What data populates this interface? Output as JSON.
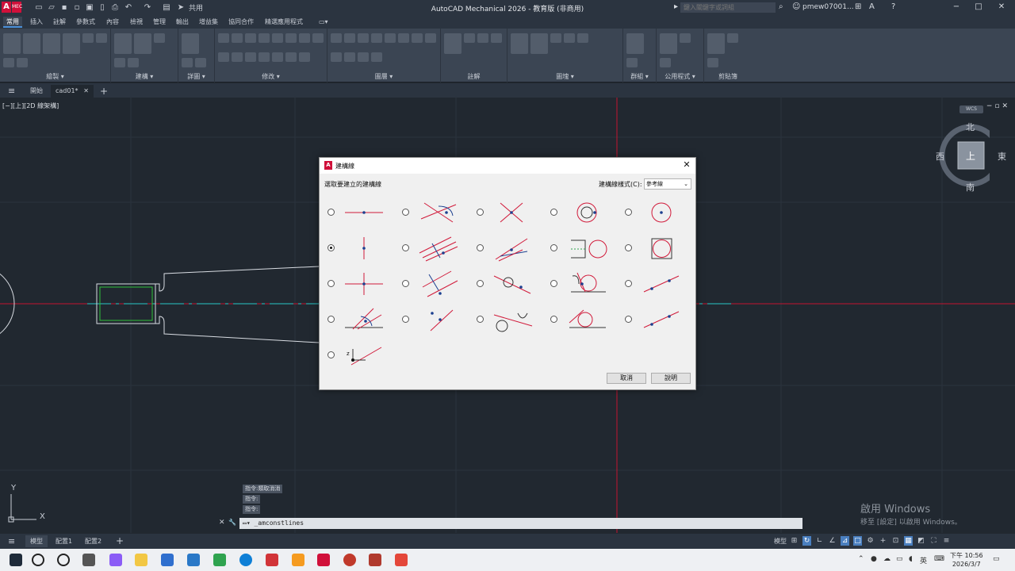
{
  "app": {
    "title": "AutoCAD Mechanical 2026 - 教育版 (非商用)",
    "logo": "A",
    "logo_sub": "MEC",
    "share": "共用",
    "search_placeholder": "鍵入關鍵字或詞組",
    "user": "pmew07001...",
    "window_controls": [
      "−",
      "□",
      "✕"
    ]
  },
  "ribbon": {
    "tabs": [
      "常用",
      "插入",
      "註解",
      "參數式",
      "內容",
      "檢視",
      "管理",
      "輸出",
      "增益集",
      "協同合作",
      "精選應用程式",
      "▭▾"
    ],
    "active_tab": "常用",
    "panels": [
      "繪製 ▾",
      "建構 ▾",
      "詳圖 ▾",
      "修改 ▾",
      "圖層 ▾",
      "註解",
      "圖塊 ▾",
      "群組 ▾",
      "公用程式 ▾",
      "剪貼簿"
    ]
  },
  "doc_tabs": {
    "menu": "≡",
    "start": "開始",
    "active": "cad01*",
    "close": "✕",
    "add": "+"
  },
  "viewport": {
    "label": "[−][上][2D 線架構]",
    "controls": "−▫✕",
    "viewcube": {
      "north": "北",
      "south": "南",
      "east": "東",
      "west": "西",
      "face": "上"
    },
    "wcs": "WCS",
    "ucs_x": "X",
    "ucs_y": "Y"
  },
  "command": {
    "history": [
      "指令:類取消消",
      "指令:",
      "指令:"
    ],
    "input": "▭▾ _amconstlines",
    "close": "✕",
    "wrench": "🔧"
  },
  "activate": {
    "line1": "啟用 Windows",
    "line2": "移至 [設定] 以啟用 Windows。"
  },
  "layout_tabs": {
    "menu": "≡",
    "items": [
      "模型",
      "配置1",
      "配置2"
    ],
    "add": "+",
    "status_model": "模型"
  },
  "taskbar": {
    "time": "下午 10:56",
    "date": "2026/3/7",
    "ime": "英"
  },
  "dialog": {
    "title": "建構線",
    "prompt": "選取要建立的建構線",
    "mode_label": "建構線樣式(C):",
    "mode_value": "參考線",
    "selected_option": 5,
    "buttons": {
      "cancel": "取消",
      "help": "說明"
    }
  },
  "colors": {
    "accent": "#4a90d9",
    "construction_red": "#d11a3a",
    "point_blue": "#1b3f8f",
    "canvas": "#212830"
  }
}
